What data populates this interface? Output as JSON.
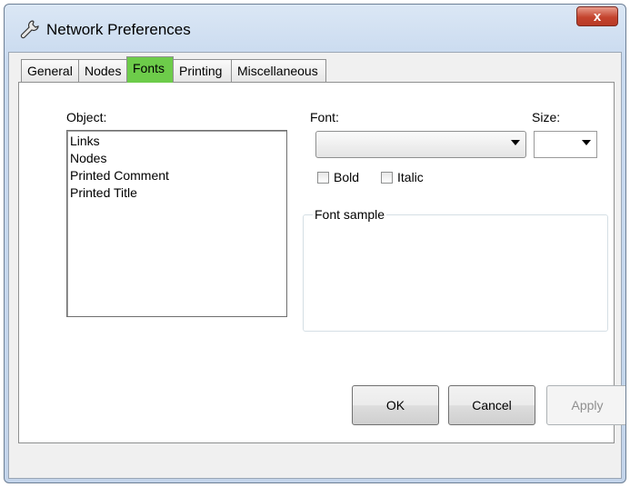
{
  "window": {
    "title": "Network Preferences",
    "close_label": "x"
  },
  "tabs": [
    {
      "label": "General",
      "active": false
    },
    {
      "label": "Nodes",
      "active": false
    },
    {
      "label": "Fonts",
      "active": true
    },
    {
      "label": "Printing",
      "active": false
    },
    {
      "label": "Miscellaneous",
      "active": false
    }
  ],
  "fonts_panel": {
    "object_label": "Object:",
    "objects": [
      "Links",
      "Nodes",
      "Printed Comment",
      "Printed Title"
    ],
    "font_label": "Font:",
    "font_value": "",
    "size_label": "Size:",
    "size_value": "",
    "bold_label": "Bold",
    "bold_checked": false,
    "italic_label": "Italic",
    "italic_checked": false,
    "font_sample_label": "Font sample"
  },
  "buttons": {
    "ok": "OK",
    "cancel": "Cancel",
    "apply": "Apply",
    "apply_enabled": false
  },
  "colors": {
    "active_tab": "#6dcc4a",
    "close_button": "#c4442e"
  }
}
